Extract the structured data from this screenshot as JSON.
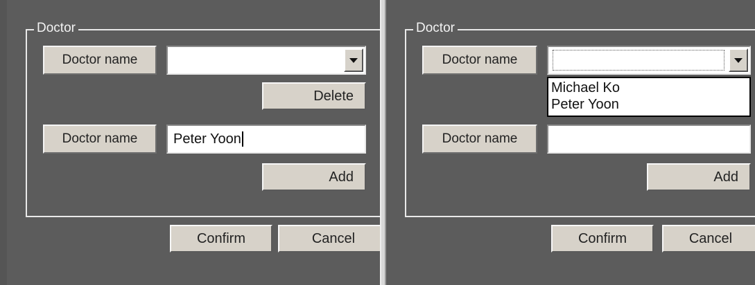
{
  "left": {
    "group_title": "Doctor",
    "row1_label": "Doctor name",
    "row1_value": "",
    "delete_label": "Delete",
    "row2_label": "Doctor name",
    "row2_value": "Peter Yoon",
    "add_label": "Add",
    "confirm_label": "Confirm",
    "cancel_label": "Cancel"
  },
  "right": {
    "group_title": "Doctor",
    "row1_label": "Doctor name",
    "row1_value": "",
    "dropdown_options": [
      "Michael Ko",
      "Peter Yoon"
    ],
    "row2_label": "Doctor name",
    "row2_value": "",
    "add_label": "Add",
    "confirm_label": "Confirm",
    "cancel_label": "Cancel"
  }
}
